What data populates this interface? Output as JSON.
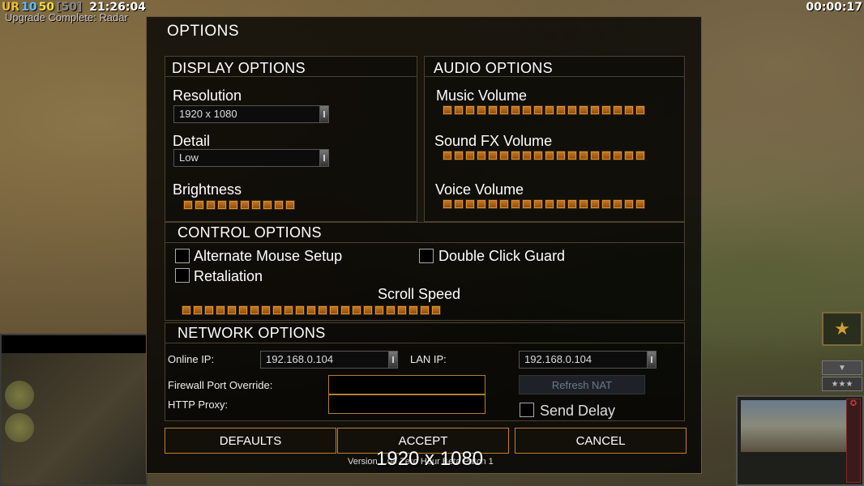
{
  "hud": {
    "counter_1": "UR",
    "counter_2": "10",
    "counter_3": "50",
    "counter_4": "[50]",
    "clock": "21:26:04",
    "status": "Upgrade Complete: Radar",
    "timer": "00:00:17"
  },
  "dialog": {
    "title": "OPTIONS",
    "display": {
      "title": "DISPLAY OPTIONS",
      "resolution_label": "Resolution",
      "resolution_value": "1920 x 1080",
      "detail_label": "Detail",
      "detail_value": "Low",
      "brightness_label": "Brightness",
      "brightness_level": 1.0
    },
    "audio": {
      "title": "AUDIO OPTIONS",
      "music_label": "Music Volume",
      "music_level": 1.0,
      "sfx_label": "Sound FX Volume",
      "sfx_level": 1.0,
      "voice_label": "Voice Volume",
      "voice_level": 1.0
    },
    "control": {
      "title": "CONTROL OPTIONS",
      "alt_mouse_label": "Alternate Mouse Setup",
      "alt_mouse_checked": false,
      "double_click_label": "Double Click Guard",
      "double_click_checked": false,
      "retaliation_label": "Retaliation",
      "retaliation_checked": false,
      "scroll_speed_label": "Scroll Speed",
      "scroll_speed_level": 1.0
    },
    "network": {
      "title": "NETWORK OPTIONS",
      "online_ip_label": "Online IP:",
      "online_ip_value": "192.168.0.104",
      "lan_ip_label": "LAN IP:",
      "lan_ip_value": "192.168.0.104",
      "firewall_label": "Firewall Port Override:",
      "firewall_value": "",
      "proxy_label": "HTTP Proxy:",
      "proxy_value": "",
      "refresh_nat_label": "Refresh NAT",
      "send_delay_label": "Send Delay",
      "send_delay_checked": false
    },
    "buttons": {
      "defaults": "DEFAULTS",
      "accept": "ACCEPT",
      "cancel": "CANCEL"
    },
    "version_text": "Version 1.04 Zero Hour Beta Patch 1",
    "resolution_overlay": "1920 x 1080"
  },
  "colors": {
    "accent": "#c08030",
    "slider_fill": "#c77a20",
    "panel_border": "#4a4030"
  },
  "icons": {
    "rank": "star-emblem-icon",
    "scroll_down": "arrow-down-icon",
    "stars": "three-stars-icon"
  }
}
